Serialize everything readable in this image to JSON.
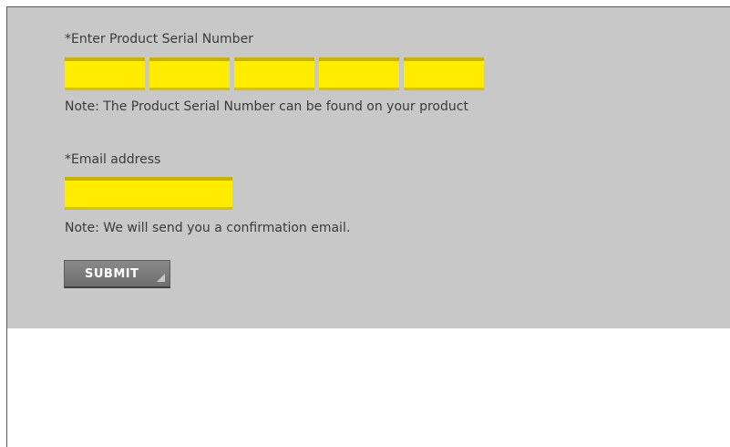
{
  "serial": {
    "label": "*Enter Product Serial Number",
    "note": "Note: The Product Serial Number can be found on your product",
    "fields": [
      "",
      "",
      "",
      "",
      ""
    ]
  },
  "email": {
    "label": "*Email address",
    "value": "",
    "note": "Note: We will send you a confirmation email."
  },
  "submit": {
    "label": "SUBMIT"
  },
  "colors": {
    "panel": "#c8c8c8",
    "input_fill": "#ffec00",
    "button": "#787878"
  }
}
